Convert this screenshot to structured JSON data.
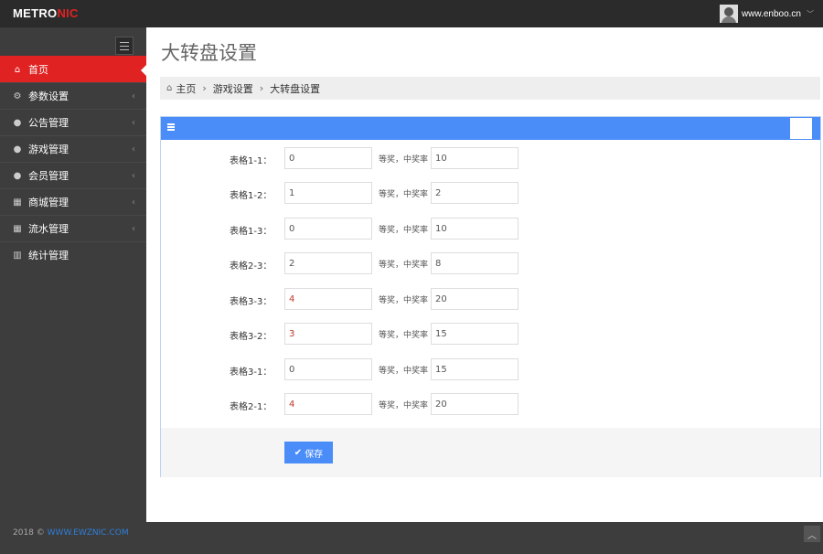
{
  "topbar": {
    "logo_main": "METRO",
    "logo_accent": "NIC",
    "username": "www.enboo.cn"
  },
  "sidebar": {
    "items": [
      {
        "label": "首页",
        "icon": "home-icon",
        "active": true
      },
      {
        "label": "参数设置",
        "icon": "cogs-icon"
      },
      {
        "label": "公告管理",
        "icon": "user-icon"
      },
      {
        "label": "游戏管理",
        "icon": "user-icon"
      },
      {
        "label": "会员管理",
        "icon": "user-icon"
      },
      {
        "label": "商城管理",
        "icon": "table-icon"
      },
      {
        "label": "流水管理",
        "icon": "table-icon"
      },
      {
        "label": "统计管理",
        "icon": "bar-chart-icon"
      }
    ]
  },
  "page": {
    "title": "大转盘设置"
  },
  "breadcrumb": {
    "home": "主页",
    "level2": "游戏设置",
    "level3": "大转盘设置"
  },
  "form": {
    "mid_label": "等奖，中奖率",
    "rows": [
      {
        "label": "表格1-1：",
        "prize": "0",
        "rate": "10"
      },
      {
        "label": "表格1-2：",
        "prize": "1",
        "rate": "2"
      },
      {
        "label": "表格1-3：",
        "prize": "0",
        "rate": "10"
      },
      {
        "label": "表格2-3：",
        "prize": "2",
        "rate": "8"
      },
      {
        "label": "表格3-3：",
        "prize": "4",
        "rate": "20"
      },
      {
        "label": "表格3-2：",
        "prize": "3",
        "rate": "15"
      },
      {
        "label": "表格3-1：",
        "prize": "0",
        "rate": "15"
      },
      {
        "label": "表格2-1：",
        "prize": "4",
        "rate": "20"
      }
    ],
    "save_label": "保存"
  },
  "footer": {
    "year": "2018 © ",
    "link": "WWW.EWZNIC.COM"
  },
  "colors": {
    "accent_red": "#e02222",
    "accent_blue": "#4b8df8"
  }
}
